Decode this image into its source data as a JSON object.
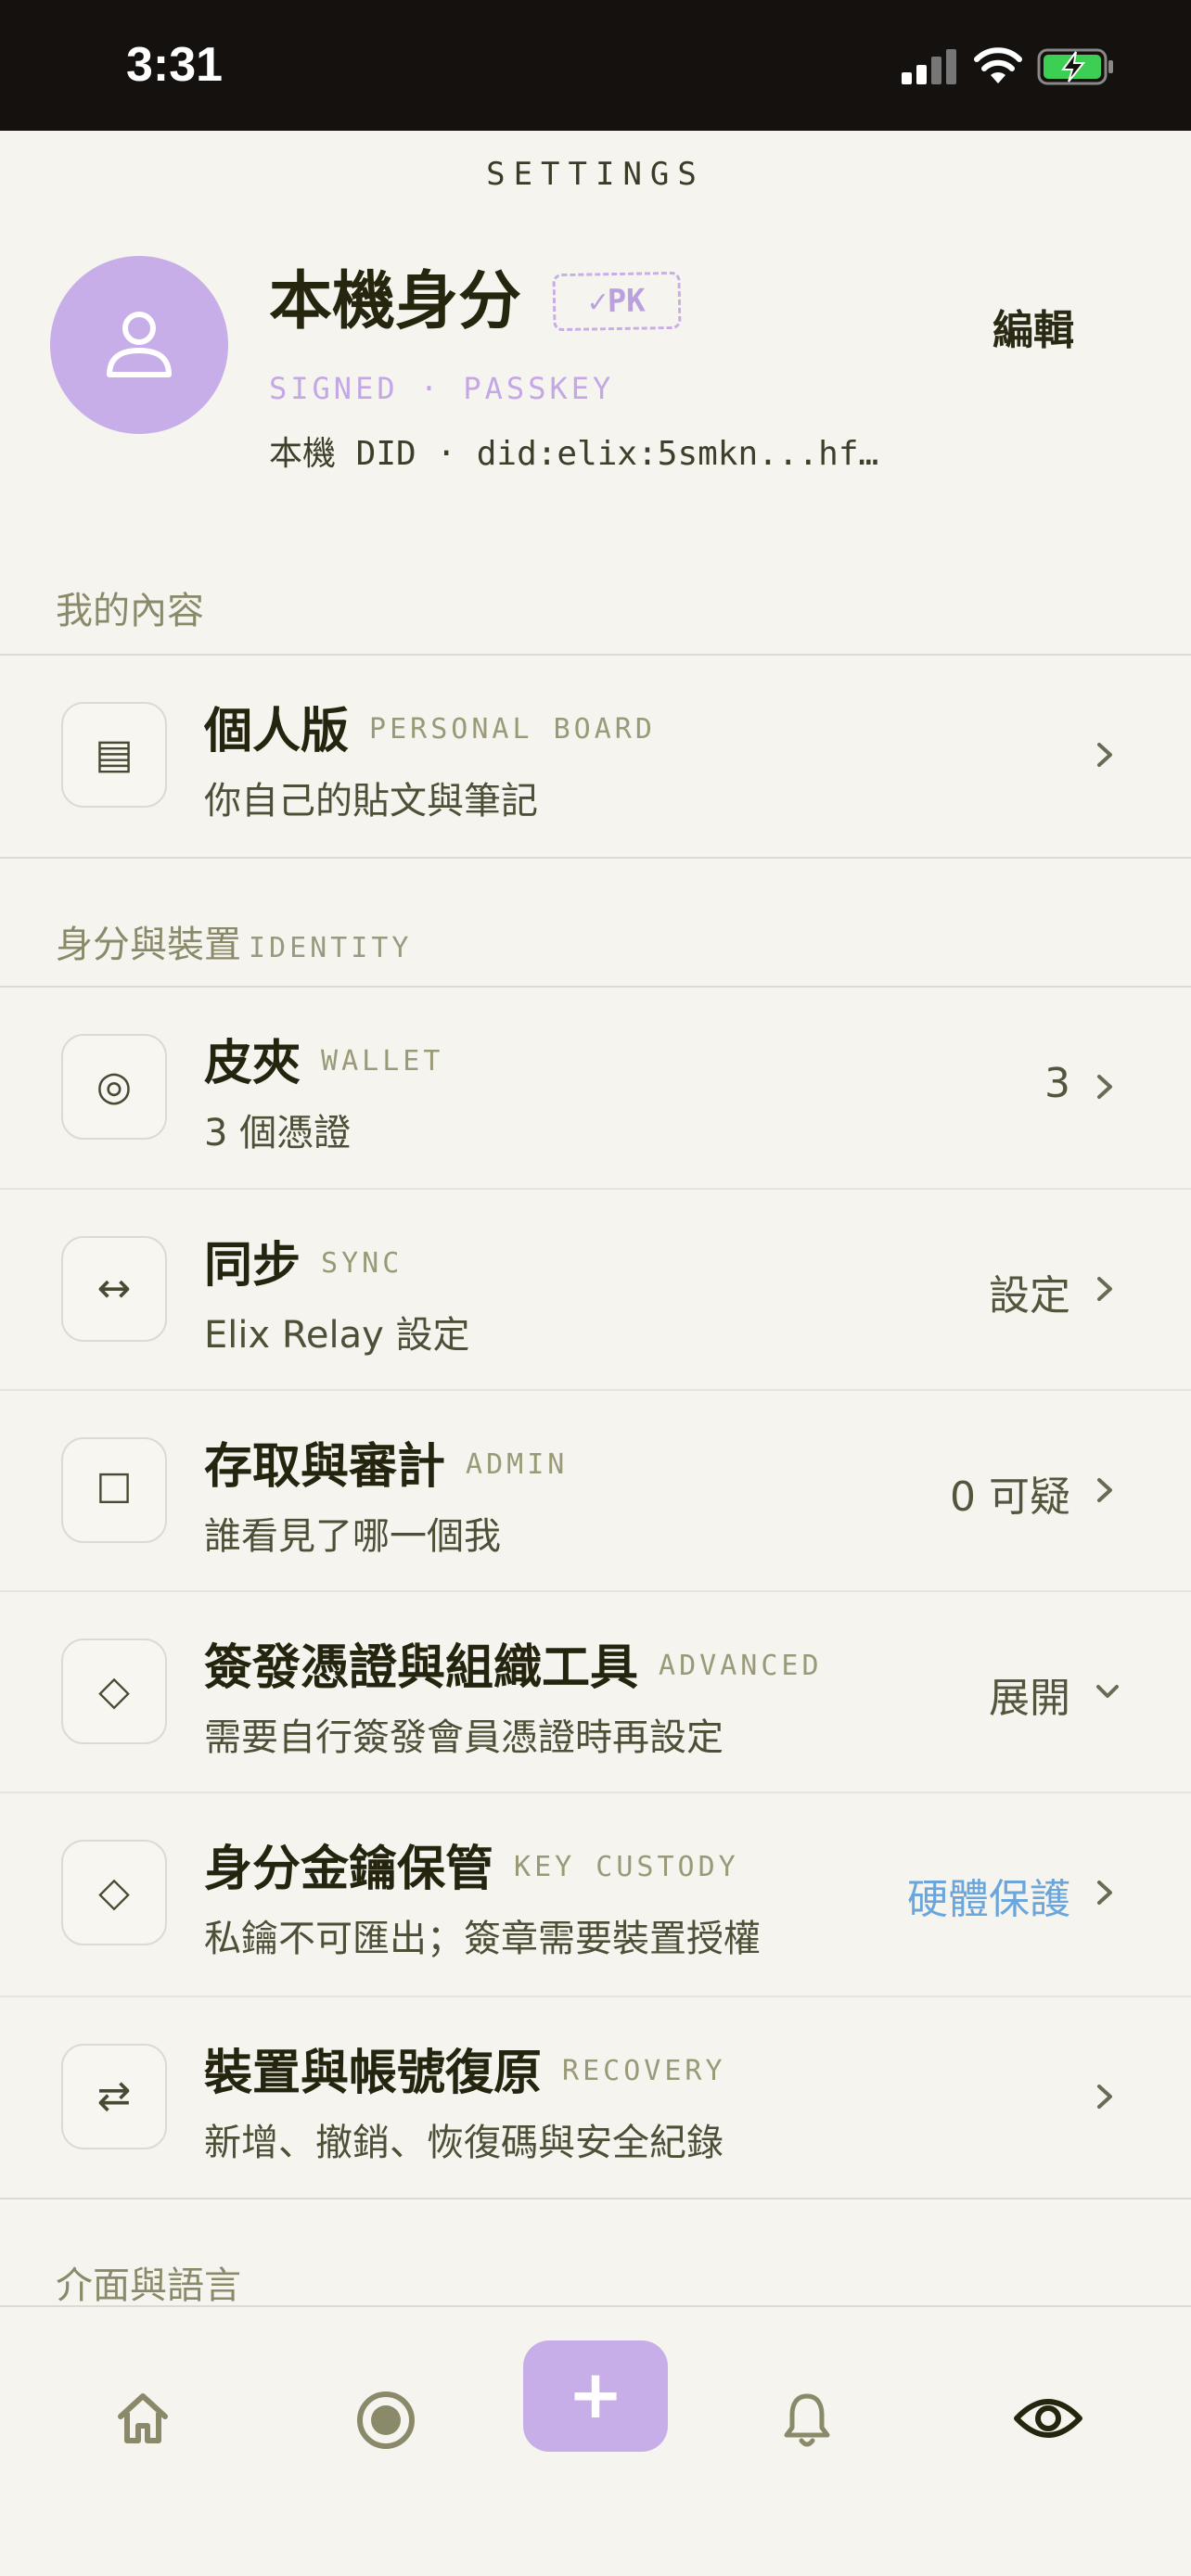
{
  "status_bar": {
    "time": "3:31"
  },
  "header": {
    "title": "SETTINGS"
  },
  "profile": {
    "name": "本機身分",
    "badge": "✓PK",
    "subtitle": "SIGNED · PASSKEY",
    "did": "本機 DID · did:elix:5smkn...hf…",
    "edit_label": "編輯"
  },
  "sections": [
    {
      "label": "我的內容",
      "label_en": ""
    },
    {
      "label": "身分與裝置",
      "label_en": "IDENTITY"
    },
    {
      "label": "介面與語言",
      "label_en": ""
    }
  ],
  "rows": [
    {
      "icon": "▤",
      "title": "個人版",
      "tag": "PERSONAL BOARD",
      "desc": "你自己的貼文與筆記",
      "value": "",
      "chevron": "right"
    },
    {
      "icon": "◎",
      "title": "皮夾",
      "tag": "WALLET",
      "desc": "3 個憑證",
      "value": "3",
      "chevron": "right"
    },
    {
      "icon": "↔",
      "title": "同步",
      "tag": "SYNC",
      "desc": "Elix Relay 設定",
      "value": "設定",
      "chevron": "right"
    },
    {
      "icon": "☐",
      "title": "存取與審計",
      "tag": "ADMIN",
      "desc": "誰看見了哪一個我",
      "value": "0 可疑",
      "chevron": "right"
    },
    {
      "icon": "◇",
      "title": "簽發憑證與組織工具",
      "tag": "ADVANCED",
      "desc": "需要自行簽發會員憑證時再設定",
      "value": "展開",
      "chevron": "down"
    },
    {
      "icon": "◇",
      "title": "身分金鑰保管",
      "tag": "KEY CUSTODY",
      "desc": "私鑰不可匯出；簽章需要裝置授權",
      "value": "硬體保護",
      "chevron": "right"
    },
    {
      "icon": "⇄",
      "title": "裝置與帳號復原",
      "tag": "RECOVERY",
      "desc": "新增、撤銷、恢復碼與安全紀錄",
      "value": "",
      "chevron": "right"
    }
  ],
  "tabbar": {
    "add_label": "+",
    "tabs": [
      "home-icon",
      "record-icon",
      "bell-icon",
      "eye-icon"
    ]
  },
  "colors": {
    "accent": "#c8aee8",
    "link_blue": "#6aa6dc",
    "background": "#f5f4ee"
  }
}
